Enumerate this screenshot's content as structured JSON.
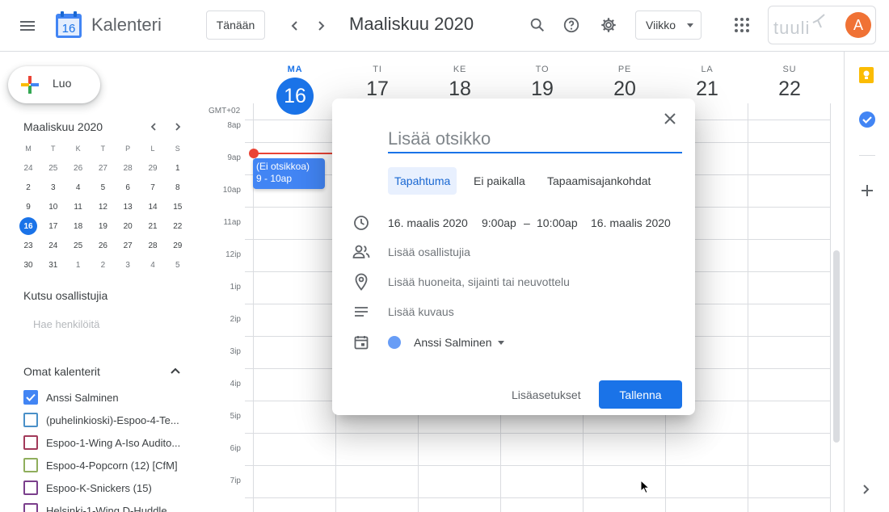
{
  "header": {
    "app_title": "Kalenteri",
    "logo_day": "16",
    "today_label": "Tänään",
    "month_title": "Maaliskuu 2020",
    "view_label": "Viikko",
    "brand": "tuuli",
    "avatar_letter": "A"
  },
  "sidebar": {
    "create_label": "Luo",
    "mini_calendar": {
      "title": "Maaliskuu 2020",
      "weekdays": [
        "M",
        "T",
        "K",
        "T",
        "P",
        "L",
        "S"
      ],
      "weeks": [
        [
          "24",
          "25",
          "26",
          "27",
          "28",
          "29",
          "1"
        ],
        [
          "2",
          "3",
          "4",
          "5",
          "6",
          "7",
          "8"
        ],
        [
          "9",
          "10",
          "11",
          "12",
          "13",
          "14",
          "15"
        ],
        [
          "16",
          "17",
          "18",
          "19",
          "20",
          "21",
          "22"
        ],
        [
          "23",
          "24",
          "25",
          "26",
          "27",
          "28",
          "29"
        ],
        [
          "30",
          "31",
          "1",
          "2",
          "3",
          "4",
          "5"
        ]
      ],
      "today": "16"
    },
    "invite_title": "Kutsu osallistujia",
    "search_people_placeholder": "Hae henkilöitä",
    "my_calendars_title": "Omat kalenterit",
    "calendars": [
      {
        "name": "Anssi Salminen",
        "color": "#4285f4",
        "checked": true
      },
      {
        "name": "(puhelinkioski)-Espoo-4-Te...",
        "color": "#4a90c8",
        "checked": false
      },
      {
        "name": "Espoo-1-Wing A-Iso Audito...",
        "color": "#a23a5a",
        "checked": false
      },
      {
        "name": "Espoo-4-Popcorn (12) [CfM]",
        "color": "#8fae5c",
        "checked": false
      },
      {
        "name": "Espoo-K-Snickers (15)",
        "color": "#7b3f8c",
        "checked": false
      },
      {
        "name": "Helsinki-1-Wing D-Huddle...",
        "color": "#7b3f8c",
        "checked": false
      }
    ]
  },
  "week": {
    "timezone": "GMT+02",
    "days": [
      {
        "dow": "MA",
        "num": "16",
        "today": true
      },
      {
        "dow": "TI",
        "num": "17"
      },
      {
        "dow": "KE",
        "num": "18"
      },
      {
        "dow": "TO",
        "num": "19"
      },
      {
        "dow": "PE",
        "num": "20"
      },
      {
        "dow": "LA",
        "num": "21"
      },
      {
        "dow": "SU",
        "num": "22"
      }
    ],
    "hours": [
      "8ap",
      "9ap",
      "10ap",
      "11ap",
      "12ip",
      "1ip",
      "2ip",
      "3ip",
      "4ip",
      "5ip",
      "6ip",
      "7ip"
    ],
    "event": {
      "title": "(Ei otsikkoa)",
      "time": "9 - 10ap"
    }
  },
  "dialog": {
    "title_placeholder": "Lisää otsikko",
    "tabs": [
      "Tapahtuma",
      "Ei paikalla",
      "Tapaamisajankohdat"
    ],
    "start_date": "16. maalis 2020",
    "start_time": "9:00ap",
    "dash": "–",
    "end_time": "10:00ap",
    "end_date": "16. maalis 2020",
    "add_guests": "Lisää osallistujia",
    "add_location": "Lisää huoneita, sijainti tai neuvottelu",
    "add_description": "Lisää kuvaus",
    "calendar_owner": "Anssi Salminen",
    "more_options": "Lisäasetukset",
    "save": "Tallenna"
  },
  "colors": {
    "accent": "#1a73e8",
    "now_line": "#ea4335",
    "avatar": "#f07235"
  }
}
